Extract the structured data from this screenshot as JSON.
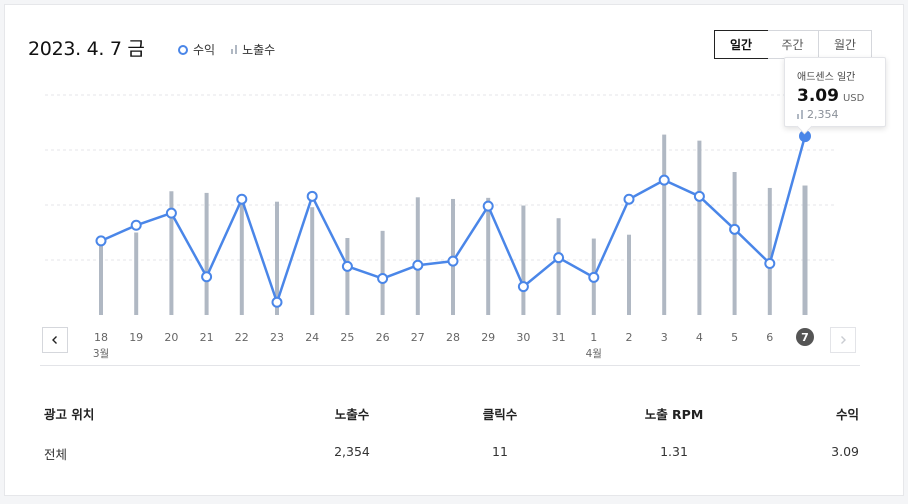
{
  "header": {
    "date_title": "2023. 4. 7 금",
    "legend": {
      "revenue": "수익",
      "impressions": "노출수"
    }
  },
  "period_tabs": [
    {
      "label": "일간",
      "active": true
    },
    {
      "label": "주간",
      "active": false
    },
    {
      "label": "월간",
      "active": false
    }
  ],
  "tooltip": {
    "label": "애드센스 일간",
    "value": "3.09",
    "unit": "USD",
    "impressions": "2,354"
  },
  "colors": {
    "line": "#4a86e8",
    "bar": "#b0b8c3",
    "selected_badge": "#555555"
  },
  "icons": {
    "prev": "chevron-left-icon",
    "next": "chevron-right-icon"
  },
  "chart_data": {
    "type": "line",
    "x": [
      "18",
      "19",
      "20",
      "21",
      "22",
      "23",
      "24",
      "25",
      "26",
      "27",
      "28",
      "29",
      "30",
      "31",
      "1",
      "2",
      "3",
      "4",
      "5",
      "6",
      "7"
    ],
    "month_labels": [
      {
        "index": 0,
        "label": "3월"
      },
      {
        "index": 14,
        "label": "4월"
      }
    ],
    "selected_index": 20,
    "series": [
      {
        "name": "수익",
        "type": "line",
        "values": [
          1.28,
          1.55,
          1.76,
          0.66,
          2.0,
          0.22,
          2.05,
          0.84,
          0.63,
          0.86,
          0.93,
          1.88,
          0.49,
          0.99,
          0.65,
          2.0,
          2.33,
          2.05,
          1.48,
          0.89,
          3.09
        ]
      },
      {
        "name": "노출수",
        "type": "bar",
        "values": [
          1400,
          1500,
          2250,
          2220,
          2180,
          2060,
          1960,
          1400,
          1530,
          2140,
          2110,
          2130,
          1990,
          1760,
          1390,
          1460,
          3280,
          3170,
          2600,
          2310,
          2354
        ]
      }
    ]
  },
  "table": {
    "headers": [
      "광고 위치",
      "노출수",
      "클릭수",
      "노출 RPM",
      "수익"
    ],
    "rows": [
      [
        "전체",
        "2,354",
        "11",
        "1.31",
        "3.09"
      ]
    ]
  }
}
